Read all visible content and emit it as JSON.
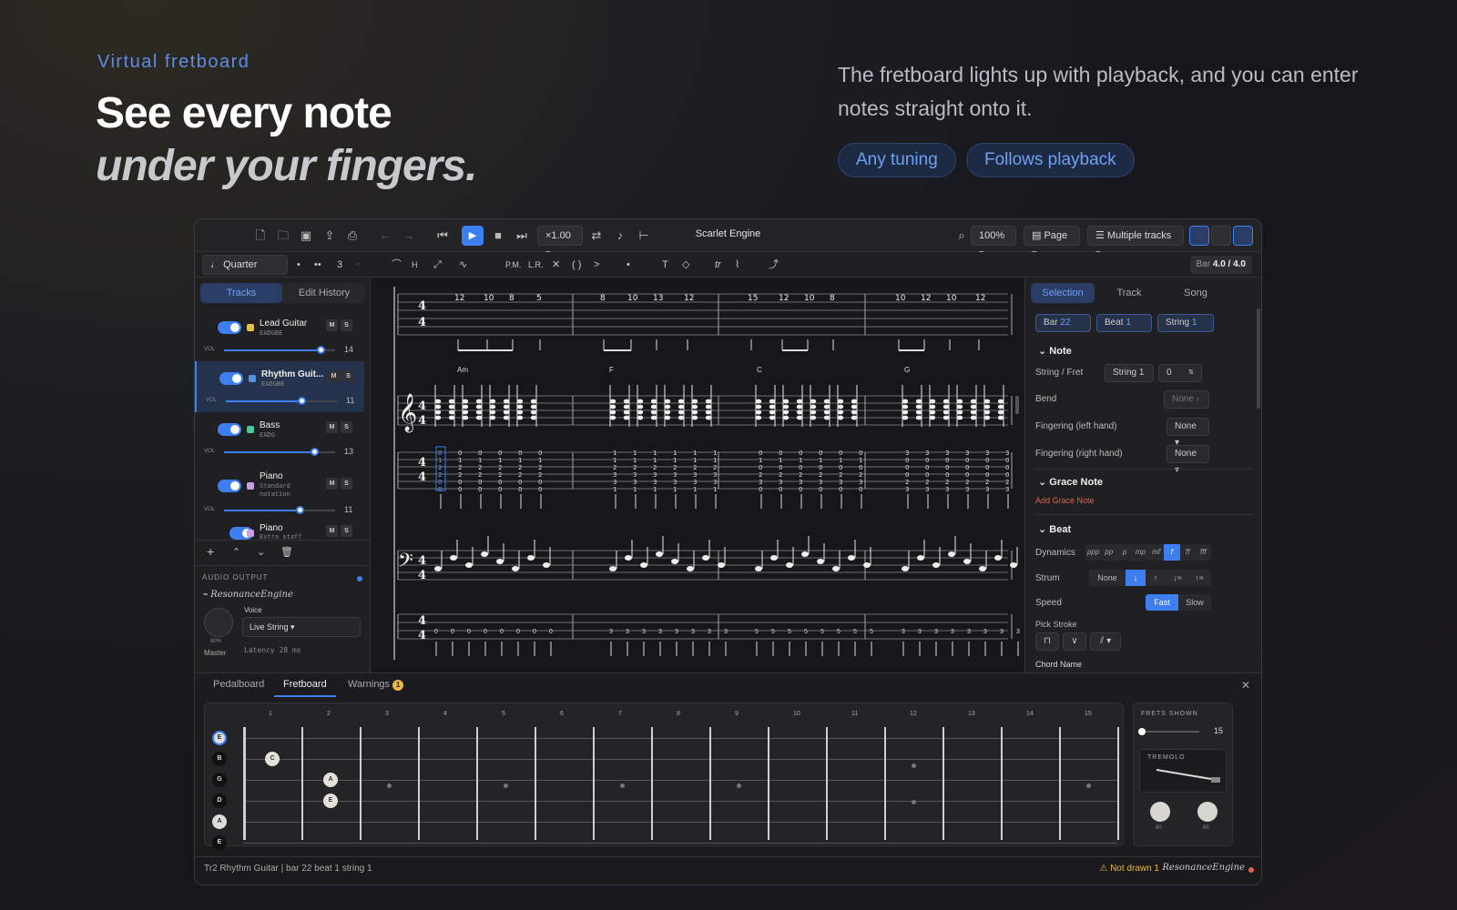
{
  "hero": {
    "eyebrow": "Virtual fretboard",
    "title_line1": "See every note",
    "title_line2": "under your fingers.",
    "description": "The fretboard lights up with playback, and you can enter notes straight onto it.",
    "pills": [
      "Any tuning",
      "Follows playback"
    ]
  },
  "app": {
    "title": "Scarlet Engine",
    "speed": "×1.00",
    "zoom": "100%",
    "view_mode": "Page",
    "track_mode": "Multiple tracks",
    "note_value": "Quarter Note",
    "tuplet": "3",
    "text_tools": {
      "pm": "P.M.",
      "lr": "L.R.",
      "tr": "tr",
      "text": "T"
    },
    "bar_position": {
      "label": "Bar",
      "value": "4.0 / 4.0"
    }
  },
  "left_panel": {
    "tabs": [
      "Tracks",
      "Edit History"
    ],
    "tracks": [
      {
        "name": "Lead Guitar",
        "tuning": "EADGBE",
        "color": "#e8c14a",
        "vol_label": "VOL",
        "volume": "14",
        "level": 0.87
      },
      {
        "name": "Rhythm Guit...",
        "tuning": "EADGBE",
        "color": "#5b8fe6",
        "vol_label": "VOL",
        "volume": "11",
        "level": 0.68
      },
      {
        "name": "Bass",
        "tuning": "EADG",
        "color": "#4cc9a0",
        "vol_label": "VOL",
        "volume": "13",
        "level": 0.81
      },
      {
        "name": "Piano",
        "tuning": "Standard notation",
        "color": "#c8a0e8",
        "vol_label": "VOL",
        "volume": "11",
        "level": 0.68
      },
      {
        "name": "Piano",
        "tuning": "Extra staff",
        "color": "#c8a0e8"
      }
    ],
    "mute_label": "M",
    "solo_label": "S",
    "audio": {
      "header": "AUDIO OUTPUT",
      "engine": "ResonanceEngine",
      "voice_label": "Voice",
      "voice_value": "Live String",
      "knob_percent": "80%",
      "master_label": "Master",
      "latency": "Latency 28 ms"
    }
  },
  "score": {
    "chords": [
      "Am",
      "F",
      "C",
      "G"
    ],
    "lead_tab": [
      "12",
      "10",
      "8",
      "5",
      "8",
      "10",
      "13",
      "12",
      "15",
      "12",
      "10",
      "8",
      "10",
      "12",
      "10",
      "12"
    ]
  },
  "right_panel": {
    "tabs": [
      "Selection",
      "Track",
      "Song"
    ],
    "chips": [
      {
        "label": "Bar",
        "value": "22"
      },
      {
        "label": "Beat",
        "value": "1"
      },
      {
        "label": "String",
        "value": "1"
      }
    ],
    "note_section": "Note",
    "string_fret_label": "String / Fret",
    "string_value": "String 1",
    "fret_value": "0",
    "bend_label": "Bend",
    "bend_value": "None",
    "finger_left_label": "Fingering (left hand)",
    "finger_left_value": "None",
    "finger_right_label": "Fingering (right hand)",
    "finger_right_value": "None",
    "grace_section": "Grace Note",
    "add_grace": "Add Grace Note",
    "beat_section": "Beat",
    "dynamics_label": "Dynamics",
    "dynamics": [
      "ppp",
      "pp",
      "p",
      "mp",
      "mf",
      "f",
      "ff",
      "fff"
    ],
    "dynamics_active": "f",
    "strum_label": "Strum",
    "strum_none": "None",
    "speed_label": "Speed",
    "speed_fast": "Fast",
    "speed_slow": "Slow",
    "pick_label": "Pick Stroke",
    "chord_name_label": "Chord Name"
  },
  "bottom_panel": {
    "tabs": [
      "Pedalboard",
      "Fretboard",
      "Warnings"
    ],
    "warnings_count": "1",
    "fret_numbers": [
      "1",
      "2",
      "3",
      "4",
      "5",
      "6",
      "7",
      "8",
      "9",
      "10",
      "11",
      "12",
      "13",
      "14",
      "15"
    ],
    "strings": [
      "E",
      "B",
      "G",
      "D",
      "A",
      "E"
    ],
    "notes": [
      {
        "label": "C",
        "string": 1,
        "fret": 1
      },
      {
        "label": "A",
        "string": 2,
        "fret": 2
      },
      {
        "label": "E",
        "string": 3,
        "fret": 2
      }
    ],
    "frets_shown_label": "FRETS SHOWN",
    "frets_shown_value": "15",
    "frets_shown_level": 0.0,
    "tremolo_label": "TREMOLO",
    "knob_values": [
      "80",
      "65"
    ]
  },
  "status": {
    "left": "Tr2 Rhythm Guitar | bar 22 beat 1 string 1",
    "warning": "Not drawn 1",
    "engine": "ResonanceEngine"
  }
}
